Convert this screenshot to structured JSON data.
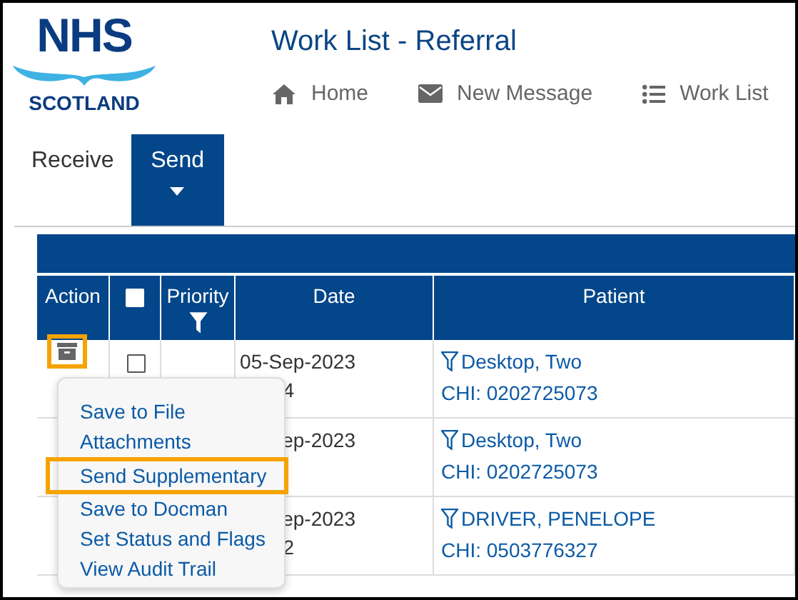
{
  "logo": {
    "title": "NHS",
    "subtitle": "SCOTLAND"
  },
  "page_title": "Work List - Referral",
  "nav": [
    {
      "kind": "home",
      "label": "Home"
    },
    {
      "kind": "message",
      "label": "New Message"
    },
    {
      "kind": "list",
      "label": "Work List"
    }
  ],
  "tabs": [
    {
      "label": "Receive",
      "selected": false
    },
    {
      "label": "Send",
      "selected": true
    }
  ],
  "table": {
    "columns": [
      "Action",
      "Priority",
      "Date",
      "Patient"
    ],
    "select_all": false,
    "rows": [
      {
        "action_highlighted": true,
        "checked": false,
        "date": "05-Sep-2023",
        "time": "4",
        "patient": "Desktop, Two",
        "chi": "CHI: 0202725073"
      },
      {
        "date": "ep-2023",
        "patient": "Desktop, Two",
        "chi": "CHI: 0202725073"
      },
      {
        "date": "ep-2023",
        "time": "2",
        "patient": "DRIVER, PENELOPE",
        "chi": "CHI: 0503776327"
      }
    ]
  },
  "action_menu": {
    "items": [
      {
        "label": "Save to File",
        "highlighted": false
      },
      {
        "label": "Attachments",
        "highlighted": false
      },
      {
        "label": "Send Supplementary",
        "highlighted": true
      },
      {
        "label": "Save to Docman",
        "highlighted": false
      },
      {
        "label": "Set Status and Flags",
        "highlighted": false
      },
      {
        "label": "View Audit Trail",
        "highlighted": false
      }
    ]
  }
}
